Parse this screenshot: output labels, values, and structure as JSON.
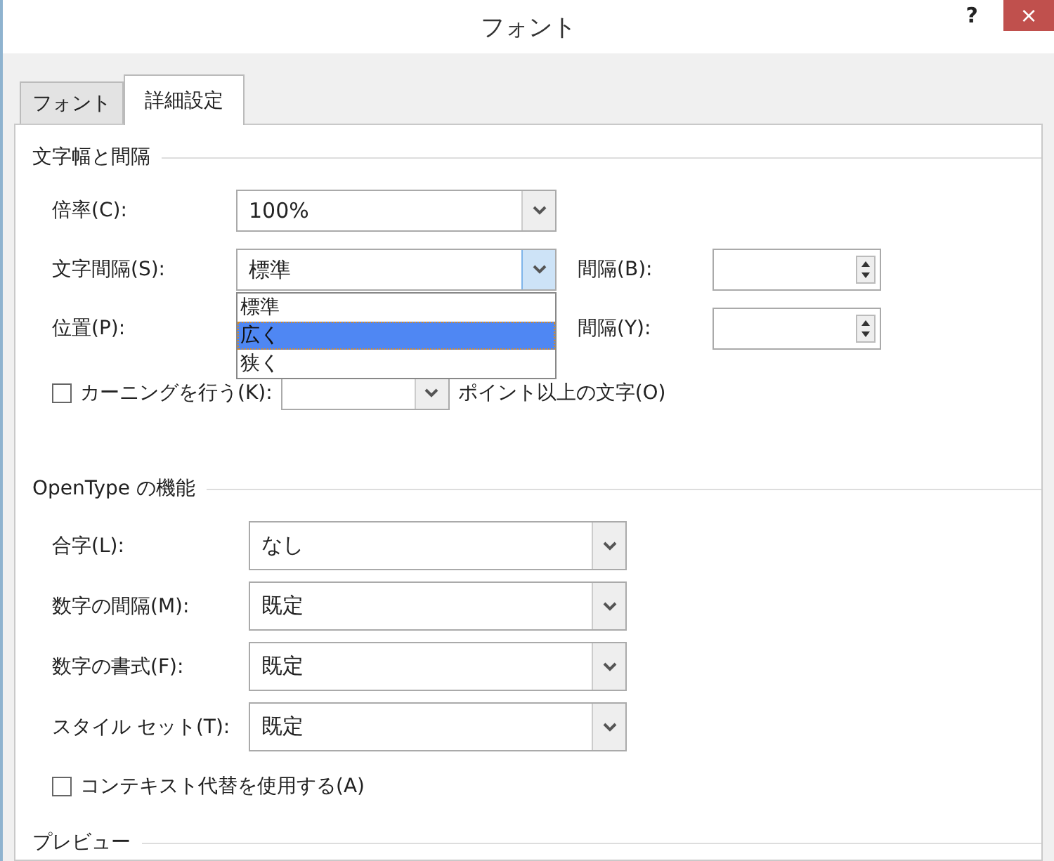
{
  "window": {
    "title": "フォント",
    "help": "?",
    "close": "×"
  },
  "tabs": [
    {
      "label": "フォント",
      "selected": false
    },
    {
      "label": "詳細設定",
      "selected": true
    }
  ],
  "spacing_group": {
    "heading": "文字幅と間隔",
    "scale": {
      "label": "倍率(C):",
      "value": "100%"
    },
    "spacing": {
      "label": "文字間隔(S):",
      "value": "標準",
      "expanded": true,
      "by_label": "間隔(B):",
      "options": [
        {
          "label": "標準",
          "highlighted": false
        },
        {
          "label": "広く",
          "highlighted": true
        },
        {
          "label": "狭く",
          "highlighted": false
        }
      ]
    },
    "position": {
      "label": "位置(P):",
      "by_label": "間隔(Y):"
    },
    "kerning": {
      "label": "カーニングを行う(K):",
      "checked": false,
      "suffix": "ポイント以上の文字(O)"
    }
  },
  "opentype_group": {
    "heading": "OpenType の機能",
    "fields": [
      {
        "label": "合字(L):",
        "value": "なし"
      },
      {
        "label": "数字の間隔(M):",
        "value": "既定"
      },
      {
        "label": "数字の書式(F):",
        "value": "既定"
      },
      {
        "label": "スタイル セット(T):",
        "value": "既定"
      }
    ],
    "contextual": {
      "label": "コンテキスト代替を使用する(A)",
      "checked": false
    }
  },
  "preview": {
    "heading": "プレビュー"
  }
}
